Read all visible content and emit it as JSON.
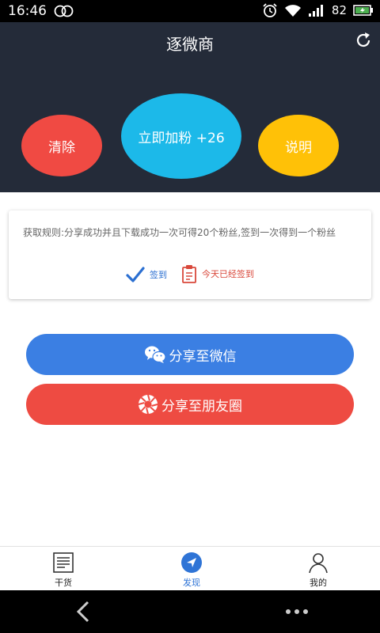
{
  "status_bar": {
    "time": "16:46",
    "battery": "82"
  },
  "header": {
    "title": "逐微商",
    "buttons": {
      "clear": "清除",
      "add_fans": "立即加粉 +26",
      "help": "说明"
    }
  },
  "rules": {
    "text": "获取规则:分享成功并且下载成功一次可得20个粉丝,签到一次得到一个粉丝",
    "checkin_label": "签到",
    "checked_status": "今天已经签到"
  },
  "share": {
    "wechat": "分享至微信",
    "moments": "分享至朋友圈"
  },
  "tabs": [
    {
      "label": "干货",
      "icon": "news-icon",
      "active": false
    },
    {
      "label": "发现",
      "icon": "navigation-icon",
      "active": true
    },
    {
      "label": "我的",
      "icon": "person-icon",
      "active": false
    }
  ],
  "colors": {
    "header_bg": "#242b39",
    "clear": "#f04a43",
    "add_fans": "#1cb9e9",
    "help": "#ffc107",
    "wechat": "#3b7fe3",
    "moments": "#ee4b42",
    "active_tab": "#2f74d6"
  }
}
